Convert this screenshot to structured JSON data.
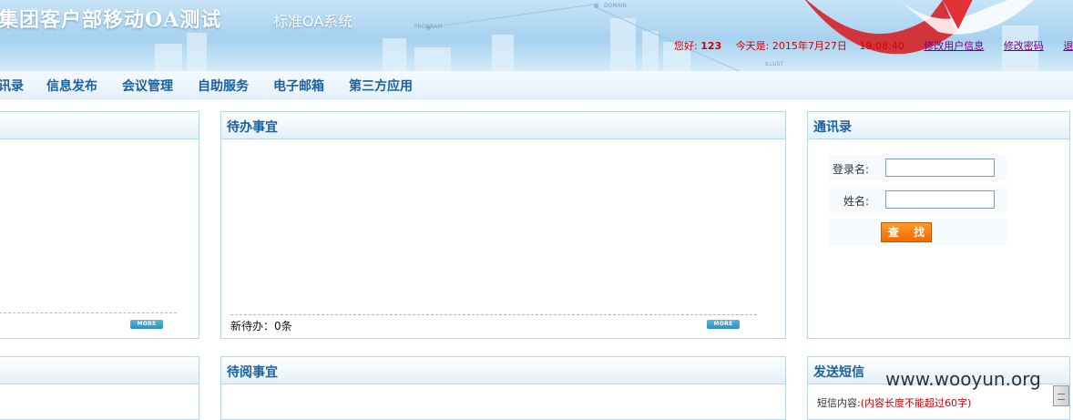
{
  "header": {
    "title": "集团客户部移动OA测试",
    "subtitle": "标准OA系统",
    "net_labels": [
      "DOMAIN",
      "PROGRAM",
      "ILLUST"
    ],
    "greeting_prefix": "您好:",
    "username": "123",
    "today_prefix": "今天是:",
    "date": "2015年7月27日",
    "time": "19:08:40",
    "links": [
      "修改用户信息",
      "修改密码",
      "退"
    ]
  },
  "nav": {
    "items": [
      "讯录",
      "信息发布",
      "会议管理",
      "自助服务",
      "电子邮箱",
      "第三方应用"
    ]
  },
  "panels": {
    "more_label": "MORE",
    "pending": {
      "title": "待办事宜",
      "count_text": "新待办：0条"
    },
    "to_read": {
      "title": "待阅事宜"
    },
    "contacts": {
      "title": "通讯录",
      "login_label": "登录名:",
      "name_label": "姓名:",
      "login_value": "",
      "name_value": "",
      "search_label": "查 找"
    },
    "sms": {
      "title": "发送短信",
      "content_label": "短信内容:",
      "limit_note": "(内容长度不能超过60字)"
    }
  },
  "watermark": "www.wooyun.org",
  "colors": {
    "nav_text": "#1a5f9e",
    "alert_red": "#d00000",
    "button_orange": "#f06a00"
  }
}
